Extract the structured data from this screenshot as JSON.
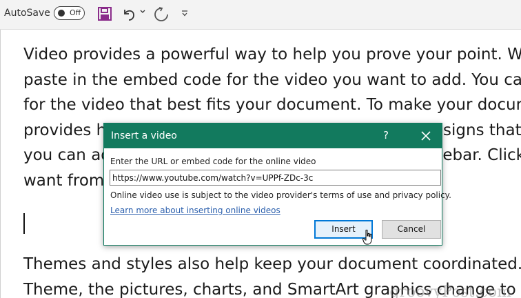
{
  "toolbar": {
    "autosave_label": "AutoSave",
    "toggle_state": "Off",
    "icons": [
      "save-icon",
      "undo-icon",
      "undo-dropdown-icon",
      "redo-icon",
      "customize-toolbar-icon"
    ]
  },
  "document": {
    "paragraph1": [
      "Video provides a powerful way to help you prove your point. When you click Online Video, you can",
      "paste in the embed code for the video you want to add. You can also type a keyword to search online",
      "for the video that best fits your document. To make your document look professionally produced, Word",
      "provides header, footer, cover page, and text box designs that complement each other. For example,",
      "you can add a matching cover page, header, and sidebar. Click Insert and then choose the elements you",
      "want from the different galleries."
    ],
    "paragraph2": [
      "Themes and styles also help keep your document coordinated. When you click Design and choose a new",
      "Theme, the pictures, charts, and SmartArt graphics change to match your new theme."
    ],
    "watermark": "groovyPost.com"
  },
  "dialog": {
    "title": "Insert a video",
    "help": "?",
    "url_label": "Enter the URL or embed code for the online video",
    "url_value": "https://www.youtube.com/watch?v=UPPf-ZDc-3c",
    "terms": "Online video use is subject to the video provider's terms of use and privacy policy.",
    "learn_more": "Learn more about inserting online videos",
    "insert_label": "Insert",
    "cancel_label": "Cancel"
  },
  "colors": {
    "accent": "#127a5e",
    "save_icon": "#8a2b8a",
    "link": "#2b5fad"
  }
}
